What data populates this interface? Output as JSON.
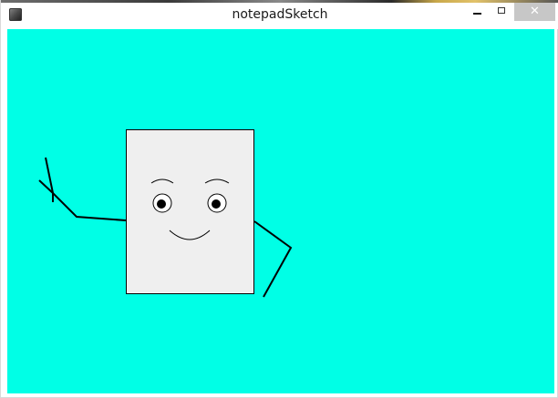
{
  "window": {
    "title": "notepadSketch",
    "close_glyph": "✕",
    "icons": {
      "app": "processing-app-icon",
      "minimize": "minimize-icon",
      "maximize": "maximize-icon",
      "close": "close-icon"
    }
  },
  "colors": {
    "canvas_background": "#00ffe6",
    "body_fill": "#efefef",
    "stroke": "#000000",
    "close_button": "#c7c7c7"
  }
}
